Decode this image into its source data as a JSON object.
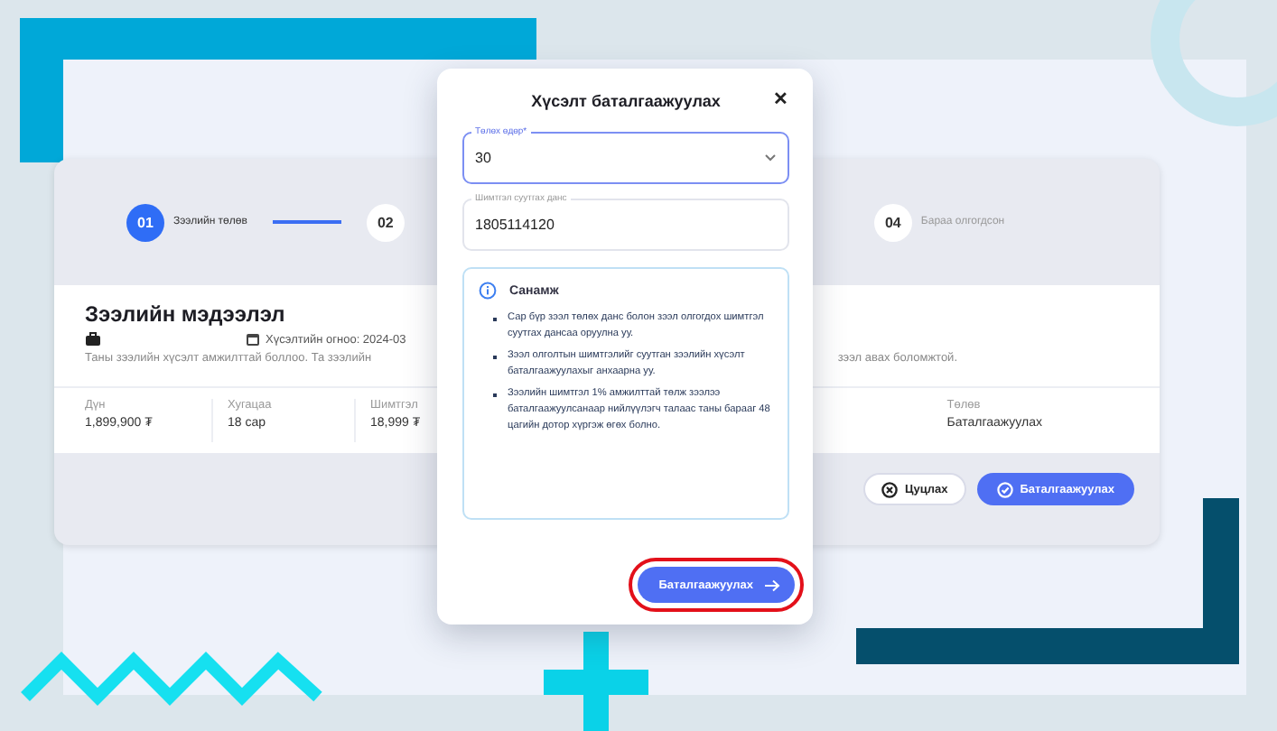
{
  "card": {
    "steps": [
      {
        "number": "01",
        "label": "Зээлийн төлөв",
        "selected": true
      },
      {
        "number": "02",
        "selected": false
      },
      {
        "number": "04",
        "label": "Бараа олгогдсон",
        "selected": false
      }
    ],
    "title": "Зээлийн мэдээлэл",
    "date": "Хүсэлтийн огноо: 2024-03",
    "description_left": "Таны зээлийн хүсэлт амжилттай боллоо. Та зээлийн",
    "description_right": "зээл авах боломжтой.",
    "stats": [
      {
        "label": "Дүн",
        "value": "1,899,900 ₮"
      },
      {
        "label": "Хугацаа",
        "value": "18 сар"
      },
      {
        "label": "Шимтгэл",
        "value": "18,999 ₮"
      },
      {
        "label": "Төлөв",
        "value": "Баталгаажуулах"
      }
    ],
    "buttons": [
      {
        "kind": "cancel",
        "label": "Цуцлах"
      },
      {
        "kind": "confirm",
        "label": "Баталгаажуулах"
      }
    ]
  },
  "dialog": {
    "title": "Хүсэлт баталгаажуулах",
    "close": "✕",
    "fields": [
      {
        "kind": "select",
        "label": "Төлөх өдөр*",
        "value": "30",
        "focused": true
      },
      {
        "kind": "text",
        "label": "Шимтгэл суутгах данс",
        "value": "1805114120",
        "focused": false
      }
    ],
    "notice": {
      "title": "Санамж",
      "items": [
        "Сар бүр зээл төлөх данс болон зээл олгогдох шимтгэл суутгах дансаа оруулна уу.",
        "Зээл олголтын шимтгэлийг суутган зээлийн хүсэлт баталгаажуулахыг анхаарна уу.",
        "Зээлийн шимтгэл 1% амжилттай төлж зээлээ баталгаажуулсанаар нийлүүлэгч талаас таны барааг 48 цагийн дотор хүргэж өгөх болно."
      ]
    },
    "button": {
      "label": "Баталгаажуулах",
      "highlighted": true
    }
  }
}
